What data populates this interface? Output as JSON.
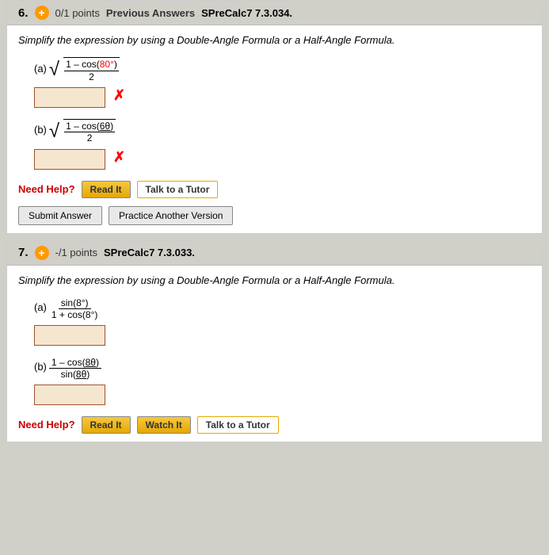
{
  "question6": {
    "number": "6.",
    "points": "0/1 points",
    "prev_answers": "Previous Answers",
    "problem_id": "SPreCalc7 7.3.034.",
    "instruction": "Simplify the expression by using a Double-Angle Formula or a Half-Angle Formula.",
    "part_a": {
      "label": "(a)",
      "expression_top": "1 – cos(80°)",
      "expression_bottom": "2",
      "angle": "80°",
      "has_error": true
    },
    "part_b": {
      "label": "(b)",
      "expression_top": "1 – cos(6θ)",
      "expression_bottom": "2",
      "angle": "6θ",
      "has_error": true
    },
    "need_help_label": "Need Help?",
    "read_it_btn": "Read It",
    "talk_tutor_btn": "Talk to a Tutor",
    "submit_btn": "Submit Answer",
    "practice_btn": "Practice Another Version"
  },
  "question7": {
    "number": "7.",
    "points": "-/1 points",
    "problem_id": "SPreCalc7 7.3.033.",
    "instruction": "Simplify the expression by using a Double-Angle Formula or a Half-Angle Formula.",
    "part_a": {
      "label": "(a)",
      "numerator": "sin(8°)",
      "denominator": "1 + cos(8°)"
    },
    "part_b": {
      "label": "(b)",
      "numerator": "1 – cos(8θ)",
      "denominator": "sin(8θ)"
    },
    "need_help_label": "Need Help?",
    "read_it_btn": "Read It",
    "watch_it_btn": "Watch It",
    "talk_tutor_btn": "Talk to a Tutor"
  }
}
